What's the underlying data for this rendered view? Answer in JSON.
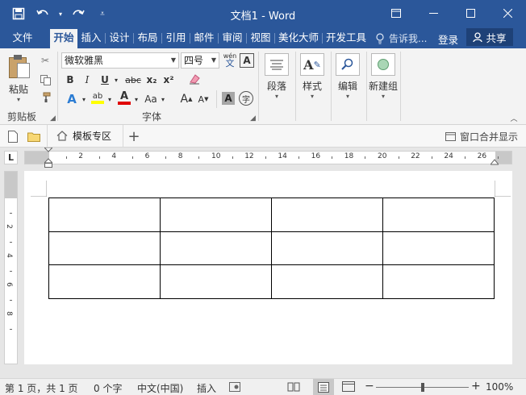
{
  "window": {
    "title": "文档1 - Word"
  },
  "qat": {
    "save": "save-icon",
    "undo": "undo-icon",
    "redo": "redo-icon",
    "customize": "customize-icon"
  },
  "tabs": [
    {
      "label": "文件"
    },
    {
      "label": "开始"
    },
    {
      "label": "插入"
    },
    {
      "label": "设计"
    },
    {
      "label": "布局"
    },
    {
      "label": "引用"
    },
    {
      "label": "邮件"
    },
    {
      "label": "审阅"
    },
    {
      "label": "视图"
    },
    {
      "label": "美化大师"
    },
    {
      "label": "开发工具"
    }
  ],
  "tellme": "告诉我...",
  "login": "登录",
  "share": "共享",
  "ribbon": {
    "clipboard": {
      "paste": "粘贴",
      "group": "剪贴板"
    },
    "font": {
      "name": "微软雅黑",
      "size": "四号",
      "group": "字体",
      "bold": "B",
      "italic": "I",
      "underline": "U",
      "strike": "abc",
      "sub": "x₂",
      "sup": "x²",
      "aa": "Aa",
      "fontcolor": "A",
      "enlarge": "A",
      "shrink": "A",
      "charshade": "A",
      "phonetic": "wén",
      "phonetic2": "文",
      "encircle": "字"
    },
    "paragraph": {
      "label": "段落"
    },
    "styles": {
      "label": "样式"
    },
    "editing": {
      "label": "编辑"
    },
    "newgroup": {
      "label": "新建组"
    }
  },
  "doctabs": {
    "template": "模板专区",
    "merge": "窗口合并显示"
  },
  "ruler": {
    "h_ticks": [
      "2",
      "4",
      "6",
      "8",
      "10",
      "12",
      "14",
      "16",
      "18",
      "20",
      "22",
      "24",
      "26"
    ],
    "v_ticks": [
      "2",
      "4",
      "6",
      "8"
    ]
  },
  "table": {
    "rows": 3,
    "cols": 4
  },
  "status": {
    "page": "第 1 页，共 1 页",
    "words": "0 个字",
    "lang": "中文(中国)",
    "mode": "插入",
    "zoom": "100%"
  },
  "colors": {
    "accent": "#2b579a",
    "highlight": "#ffff00",
    "fontcolor": "#e00000"
  }
}
